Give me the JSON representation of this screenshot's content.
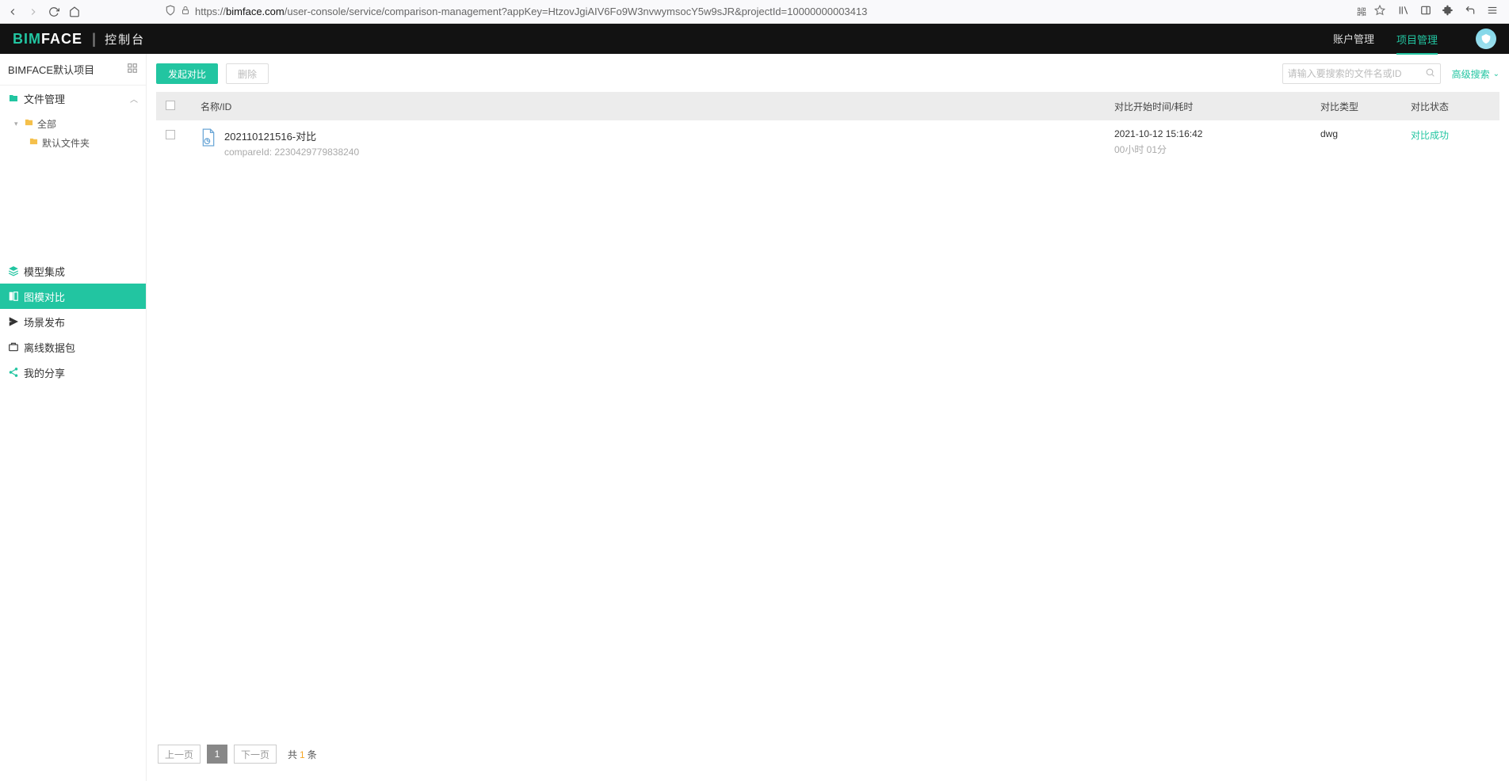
{
  "browser": {
    "url_prefix": "https://",
    "url_host": "bimface.com",
    "url_path": "/user-console/service/comparison-management?appKey=HtzovJgiAIV6Fo9W3nvwymsocY5w9sJR&projectId=10000000003413"
  },
  "header": {
    "brand_bim": "BIM",
    "brand_face": "FACE",
    "brand_sub": "控制台",
    "links": [
      "账户管理",
      "项目管理"
    ],
    "active_link_index": 1
  },
  "sidebar": {
    "project_title": "BIMFACE默认项目",
    "file_mgmt": "文件管理",
    "tree": {
      "root": "全部",
      "child": "默认文件夹"
    },
    "items": [
      {
        "label": "模型集成",
        "icon": "layers"
      },
      {
        "label": "图模对比",
        "icon": "compare",
        "active": true
      },
      {
        "label": "场景发布",
        "icon": "publish"
      },
      {
        "label": "离线数据包",
        "icon": "package"
      },
      {
        "label": "我的分享",
        "icon": "share"
      }
    ]
  },
  "toolbar": {
    "start": "发起对比",
    "delete": "删除",
    "search_placeholder": "请输入要搜索的文件名或ID",
    "advanced": "高级搜索"
  },
  "table": {
    "headers": {
      "name": "名称/ID",
      "time": "对比开始时间/耗时",
      "type": "对比类型",
      "status": "对比状态"
    },
    "rows": [
      {
        "title": "202110121516-对比",
        "compare_label": "compareId:",
        "compare_id": "2230429779838240",
        "time": "2021-10-12 15:16:42",
        "duration": "00小时 01分",
        "type": "dwg",
        "status": "对比成功"
      }
    ]
  },
  "pager": {
    "prev": "上一页",
    "next": "下一页",
    "current": "1",
    "total_prefix": "共",
    "total_count": "1",
    "total_suffix": "条"
  }
}
